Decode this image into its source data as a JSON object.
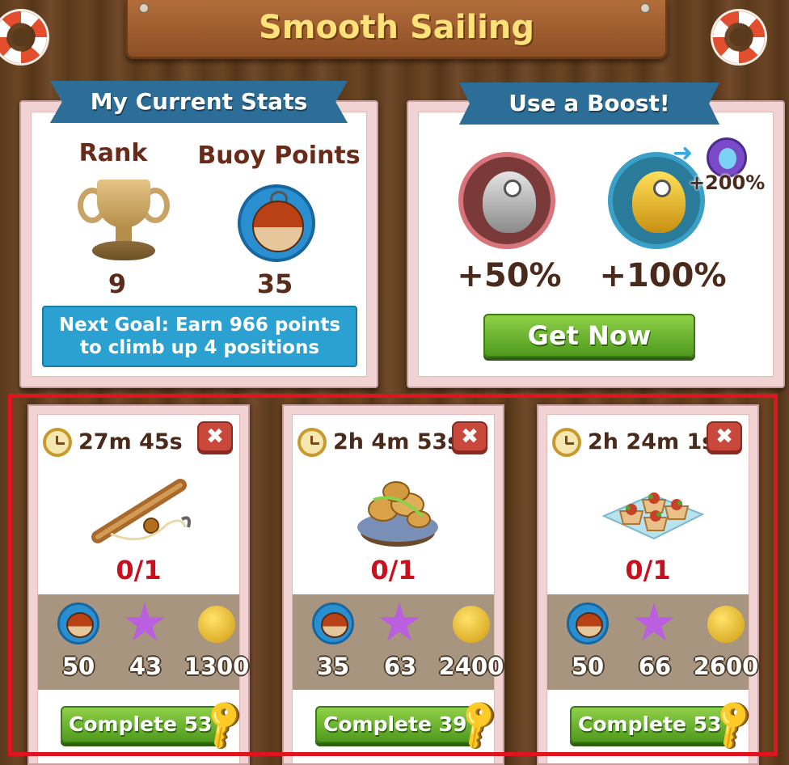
{
  "title": "Smooth Sailing",
  "stats_panel": {
    "heading": "My Current Stats",
    "rank_label": "Rank",
    "rank_value": "9",
    "points_label": "Buoy Points",
    "points_value": "35",
    "next_goal_line1": "Next Goal: Earn 966 points",
    "next_goal_line2": "to climb up 4 positions"
  },
  "boost_panel": {
    "heading": "Use a Boost!",
    "silver_pct": "+50%",
    "gold_pct": "+100%",
    "upgrade_pct": "+200%",
    "get_now_label": "Get Now"
  },
  "tasks": [
    {
      "timer": "27m 45s",
      "item": "spyglass-fishing-rod",
      "progress": "0/1",
      "buoy": "50",
      "stars": "43",
      "coins": "1300",
      "complete_label": "Complete 53"
    },
    {
      "timer": "2h 4m 53s",
      "item": "bread-basket",
      "progress": "0/1",
      "buoy": "35",
      "stars": "63",
      "coins": "2400",
      "complete_label": "Complete 39"
    },
    {
      "timer": "2h 24m 1s",
      "item": "tartlet-tray",
      "progress": "0/1",
      "buoy": "50",
      "stars": "66",
      "coins": "2600",
      "complete_label": "Complete 53"
    }
  ],
  "colors": {
    "ribbon_blue": "#2d6e98",
    "goal_blue": "#2aa1d0",
    "button_green": "#6db336",
    "progress_red": "#c8101e",
    "highlight_red": "#e0141e"
  },
  "close_symbol": "✖"
}
